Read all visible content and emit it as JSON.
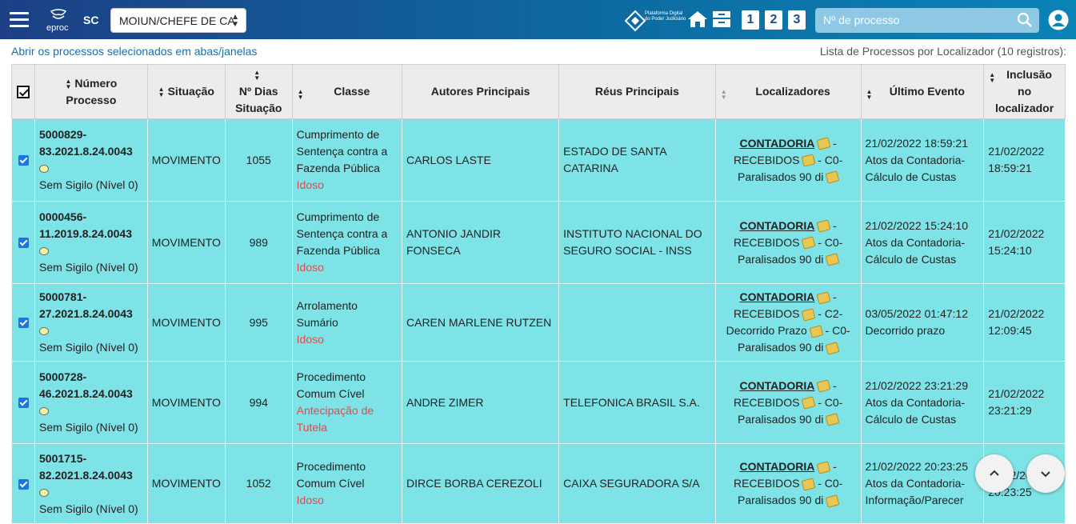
{
  "header": {
    "logo_text": "eproc",
    "state": "SC",
    "locator_select": "MOIUN/CHEFE DE CA",
    "platform_text": "Plataforma Digital do Poder Judiciário",
    "quick_nums": [
      "1",
      "2",
      "3"
    ],
    "search_placeholder": "Nº de processo"
  },
  "toolbar": {
    "open_selected": "Abrir os processos selecionados em abas/janelas",
    "list_title": "Lista de Processos por Localizador (10 registros):"
  },
  "table": {
    "headers": [
      "Número Processo",
      "Situação",
      "Nº Dias Situação",
      "Classe",
      "Autores Principais",
      "Réus Principais",
      "Localizadores",
      "Último Evento",
      "Inclusão no localizador"
    ],
    "rows": [
      {
        "num1": "5000829-",
        "num2": "83.2021.8.24.0043",
        "sigilo": "Sem Sigilo (Nível 0)",
        "situacao": "MOVIMENTO",
        "dias": "1055",
        "classe": [
          "Cumprimento de",
          "Sentença contra a",
          "Fazenda Pública"
        ],
        "classe_red": [
          "Idoso"
        ],
        "autor": "CARLOS LASTE",
        "reu": "ESTADO DE SANTA CATARINA",
        "loc": {
          "name": "CONTADORIA",
          "t1": " -",
          "t2": "RECEBIDOS",
          "t3": " - C0-",
          "t4": "Paralisados 90 di"
        },
        "evento": [
          "21/02/2022 18:59:21",
          "Atos da Contadoria-",
          "Cálculo de Custas"
        ],
        "inclusao": [
          "21/02/2022",
          "18:59:21"
        ]
      },
      {
        "num1": "0000456-",
        "num2": "11.2019.8.24.0043",
        "sigilo": "Sem Sigilo (Nível 0)",
        "situacao": "MOVIMENTO",
        "dias": "989",
        "classe": [
          "Cumprimento de",
          "Sentença contra a",
          "Fazenda Pública"
        ],
        "classe_red": [
          "Idoso"
        ],
        "autor": "ANTONIO JANDIR FONSECA",
        "reu": "INSTITUTO NACIONAL DO SEGURO SOCIAL - INSS",
        "loc": {
          "name": "CONTADORIA",
          "t1": " -",
          "t2": "RECEBIDOS",
          "t3": " - C0-",
          "t4": "Paralisados 90 di"
        },
        "evento": [
          "21/02/2022 15:24:10",
          "Atos da Contadoria-",
          "Cálculo de Custas"
        ],
        "inclusao": [
          "21/02/2022",
          "15:24:10"
        ]
      },
      {
        "num1": "5000781-",
        "num2": "27.2021.8.24.0043",
        "sigilo": "Sem Sigilo (Nível 0)",
        "situacao": "MOVIMENTO",
        "dias": "995",
        "classe": [
          "Arrolamento",
          "Sumário"
        ],
        "classe_red": [
          "Idoso"
        ],
        "autor": "CAREN MARLENE RUTZEN",
        "reu": "",
        "loc": {
          "name": "CONTADORIA",
          "t1": " -",
          "t2": "RECEBIDOS",
          "t3": " - C2-",
          "t4": "Decorrido Prazo",
          "t5": " - C0-",
          "t6": "Paralisados 90 di"
        },
        "evento": [
          "03/05/2022 01:47:12",
          "Decorrido prazo"
        ],
        "inclusao": [
          "21/02/2022",
          "12:09:45"
        ]
      },
      {
        "num1": "5000728-",
        "num2": "46.2021.8.24.0043",
        "sigilo": "Sem Sigilo (Nível 0)",
        "situacao": "MOVIMENTO",
        "dias": "994",
        "classe": [
          "Procedimento",
          "Comum Cível"
        ],
        "classe_red": [
          "Antecipação de",
          "Tutela"
        ],
        "autor": "ANDRE ZIMER",
        "reu": "TELEFONICA BRASIL S.A.",
        "loc": {
          "name": "CONTADORIA",
          "t1": " -",
          "t2": "RECEBIDOS",
          "t3": " - C0-",
          "t4": "Paralisados 90 di"
        },
        "evento": [
          "21/02/2022 23:21:29",
          "Atos da Contadoria-",
          "Cálculo de Custas"
        ],
        "inclusao": [
          "21/02/2022",
          "23:21:29"
        ]
      },
      {
        "num1": "5001715-",
        "num2": "82.2021.8.24.0043",
        "sigilo": "Sem Sigilo (Nível 0)",
        "situacao": "MOVIMENTO",
        "dias": "1052",
        "classe": [
          "Procedimento",
          "Comum Cível"
        ],
        "classe_red": [
          "Idoso"
        ],
        "autor": "DIRCE BORBA CEREZOLI",
        "reu": "CAIXA SEGURADORA S/A",
        "loc": {
          "name": "CONTADORIA",
          "t1": " -",
          "t2": "RECEBIDOS",
          "t3": " - C0-",
          "t4": "Paralisados 90 di"
        },
        "evento": [
          "21/02/2022 20:23:25",
          "Atos da Contadoria-",
          "Informação/Parecer"
        ],
        "inclusao": [
          "21/02/2022",
          "20:23:25"
        ]
      }
    ]
  }
}
